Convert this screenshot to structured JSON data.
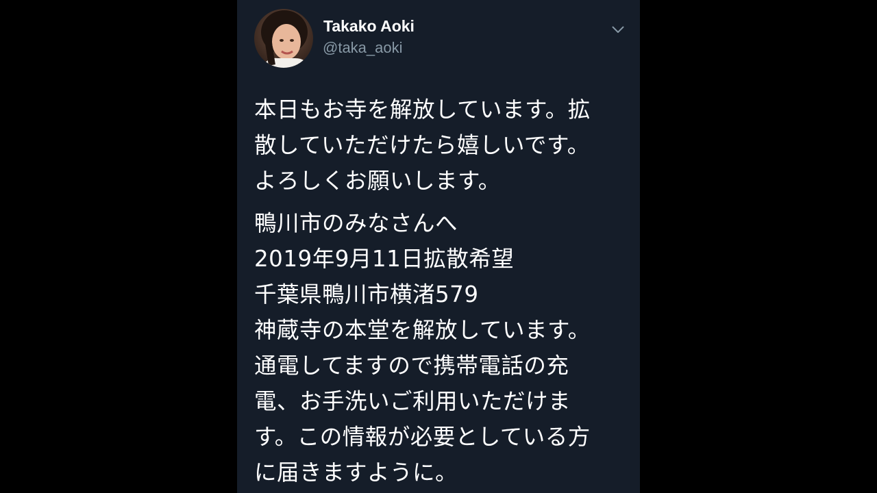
{
  "colors": {
    "page_background": "#000000",
    "card_background": "#151d29",
    "primary_text": "#ffffff",
    "secondary_text": "#8899a6"
  },
  "tweet": {
    "author": {
      "display_name": "Takako Aoki",
      "handle": "@taka_aoki",
      "avatar_icon": "user-avatar-photo"
    },
    "menu_icon": "chevron-down-icon",
    "body": {
      "paragraph_1": [
        "本日もお寺を解放しています。拡",
        "散していただけたら嬉しいです。",
        "よろしくお願いします。"
      ],
      "paragraph_2": [
        "鴨川市のみなさんへ",
        "2019年9月11日拡散希望",
        "千葉県鴨川市横渚579",
        "神蔵寺の本堂を解放しています。",
        "通電してますので携帯電話の充",
        "電、お手洗いご利用いただけま",
        "す。この情報が必要としている方",
        "に届きますように。"
      ]
    }
  }
}
